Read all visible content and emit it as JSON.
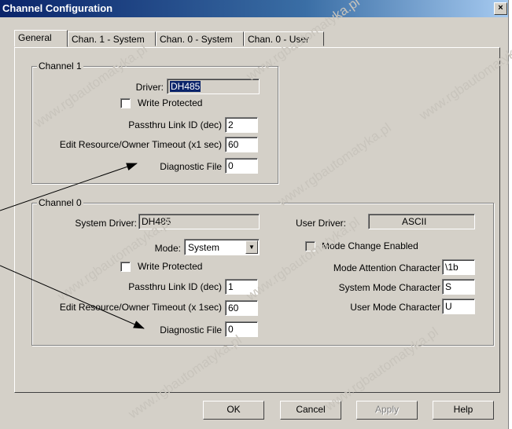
{
  "window": {
    "title": "Channel Configuration",
    "close_label": "×"
  },
  "tabs": [
    "General",
    "Chan. 1 - System",
    "Chan. 0 - System",
    "Chan. 0 - User"
  ],
  "channel1": {
    "legend": "Channel 1",
    "driver_label": "Driver:",
    "driver_value": "DH485",
    "write_protected_label": "Write Protected",
    "write_protected_checked": false,
    "passthru_label": "Passthru Link ID (dec)",
    "passthru_value": "2",
    "timeout_label": "Edit Resource/Owner Timeout (x1 sec)",
    "timeout_value": "60",
    "diag_label": "Diagnostic File",
    "diag_value": "0"
  },
  "channel0": {
    "legend": "Channel 0",
    "system_driver_label": "System Driver:",
    "system_driver_value": "DH485",
    "user_driver_label": "User Driver:",
    "user_driver_value": "ASCII",
    "mode_label": "Mode:",
    "mode_value": "System",
    "mode_change_label": "Mode Change Enabled",
    "mode_change_checked": false,
    "write_protected_label": "Write Protected",
    "write_protected_checked": false,
    "passthru_label": "Passthru Link ID (dec)",
    "passthru_value": "1",
    "timeout_label": "Edit Resource/Owner Timeout (x 1sec)",
    "timeout_value": "60",
    "diag_label": "Diagnostic File",
    "diag_value": "0",
    "mode_attention_label": "Mode Attention Character",
    "mode_attention_value": "\\1b",
    "system_mode_char_label": "System Mode Character",
    "system_mode_char_value": "S",
    "user_mode_char_label": "User Mode Character",
    "user_mode_char_value": "U"
  },
  "buttons": {
    "ok": "OK",
    "cancel": "Cancel",
    "apply": "Apply",
    "help": "Help"
  },
  "watermark": "www.rgbautomatyka.pl",
  "colors": {
    "titlebar": "#0a246a",
    "face": "#d4d0c8",
    "highlight": "#0a246a"
  }
}
